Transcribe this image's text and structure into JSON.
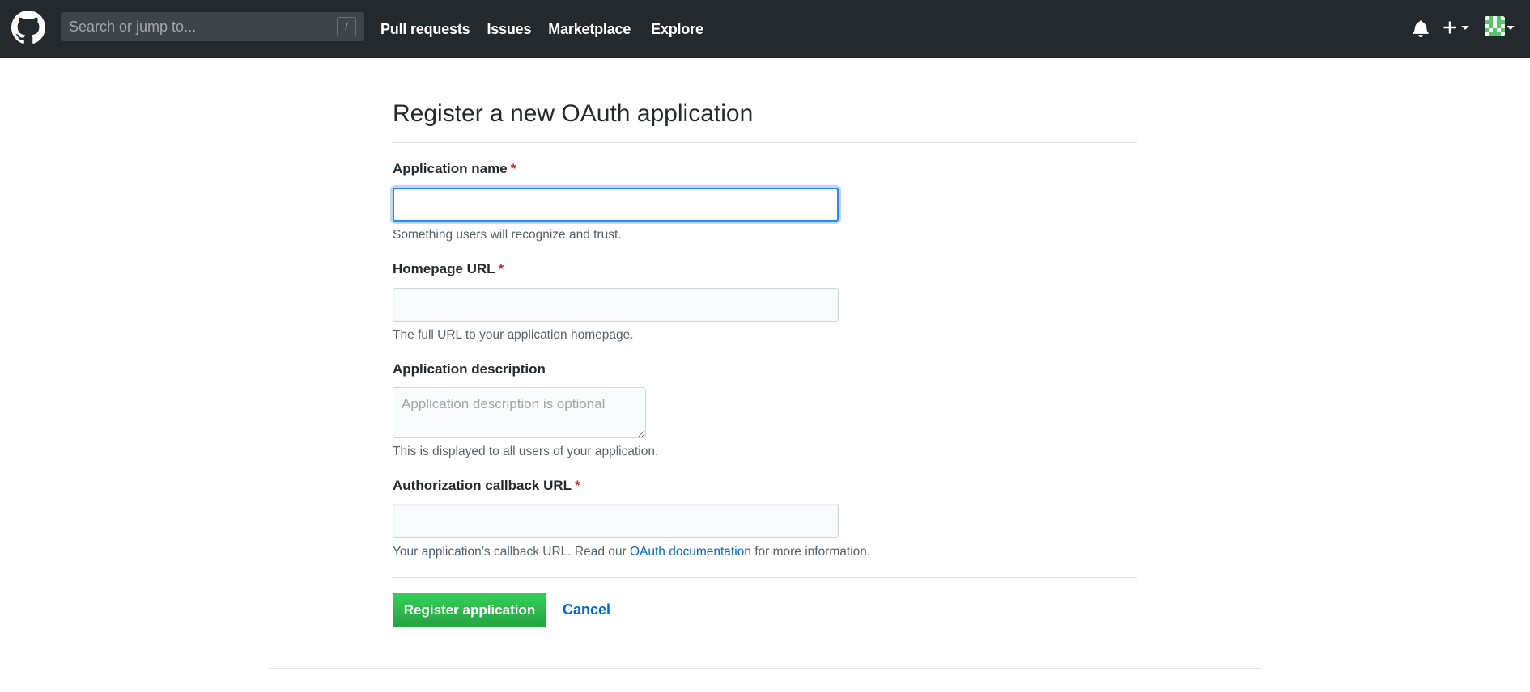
{
  "header": {
    "logo_icon": "github-mark-icon",
    "search": {
      "placeholder": "Search or jump to...",
      "value": "",
      "shortcut_key": "/"
    },
    "nav": [
      {
        "label": "Pull requests"
      },
      {
        "label": "Issues"
      },
      {
        "label": "Marketplace"
      },
      {
        "label": "Explore"
      }
    ],
    "icons": {
      "notifications": "bell-icon",
      "create_new": "plus-icon",
      "user_menu": "avatar"
    }
  },
  "page": {
    "title": "Register a new OAuth application",
    "fields": {
      "app_name": {
        "label": "Application name",
        "required_mark": "*",
        "value": "",
        "note": "Something users will recognize and trust."
      },
      "homepage_url": {
        "label": "Homepage URL",
        "required_mark": "*",
        "value": "",
        "note": "The full URL to your application homepage."
      },
      "description": {
        "label": "Application description",
        "placeholder": "Application description is optional",
        "value": "",
        "note": "This is displayed to all users of your application."
      },
      "callback_url": {
        "label": "Authorization callback URL",
        "required_mark": "*",
        "value": "",
        "note_before": "Your application’s callback URL. Read our ",
        "note_link": "OAuth documentation",
        "note_after": " for more information."
      }
    },
    "actions": {
      "submit_label": "Register application",
      "cancel_label": "Cancel"
    }
  },
  "colors": {
    "header_bg": "#24292e",
    "primary_button": "#28a745",
    "link": "#0366d6",
    "required": "#cb2431",
    "focus_ring": "#2188ff"
  }
}
